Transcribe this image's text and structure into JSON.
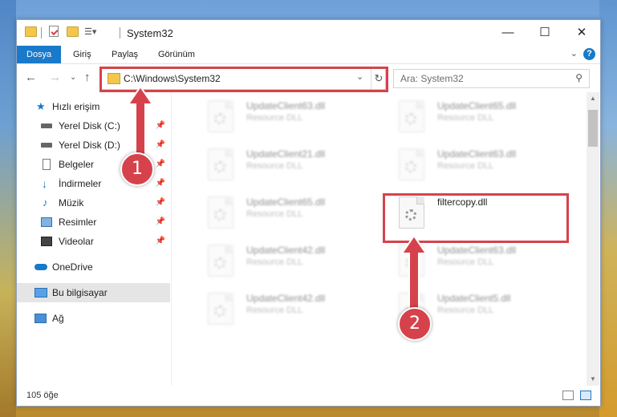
{
  "window": {
    "title": "System32",
    "controls": {
      "minimize": "—",
      "maximize": "☐",
      "close": "✕"
    }
  },
  "ribbon": {
    "tabs": [
      {
        "label": "Dosya",
        "active": true
      },
      {
        "label": "Giriş"
      },
      {
        "label": "Paylaş"
      },
      {
        "label": "Görünüm"
      }
    ],
    "help": "?"
  },
  "navigation": {
    "address": "C:\\Windows\\System32",
    "search_placeholder": "Ara: System32"
  },
  "sidebar": {
    "quick_access": "Hızlı erişim",
    "items": [
      {
        "label": "Yerel Disk (C:)",
        "icon": "drive-icon",
        "pinned": true
      },
      {
        "label": "Yerel Disk (D:)",
        "icon": "drive-icon",
        "pinned": true
      },
      {
        "label": "Belgeler",
        "icon": "documents-icon",
        "pinned": true
      },
      {
        "label": "İndirmeler",
        "icon": "downloads-icon",
        "pinned": true
      },
      {
        "label": "Müzik",
        "icon": "music-icon",
        "pinned": true
      },
      {
        "label": "Resimler",
        "icon": "pictures-icon",
        "pinned": true
      },
      {
        "label": "Videolar",
        "icon": "videos-icon",
        "pinned": true
      }
    ],
    "onedrive": "OneDrive",
    "this_pc": "Bu bilgisayar",
    "network": "Ağ"
  },
  "files": [
    {
      "name": "UpdateClient63.dll",
      "type": "Resource DLL"
    },
    {
      "name": "UpdateClient65.dll",
      "type": "Resource DLL"
    },
    {
      "name": "UpdateClient21.dll",
      "type": "Resource DLL"
    },
    {
      "name": "UpdateClient63.dll",
      "type": "Resource DLL"
    },
    {
      "name": "UpdateClient65.dll",
      "type": "Resource DLL"
    },
    {
      "name": "filtercopy.dll",
      "type": ""
    },
    {
      "name": "UpdateClient42.dll",
      "type": "Resource DLL"
    },
    {
      "name": "UpdateClient63.dll",
      "type": "Resource DLL"
    },
    {
      "name": "UpdateClient42.dll",
      "type": "Resource DLL"
    },
    {
      "name": "UpdateClient5.dll",
      "type": "Resource DLL"
    }
  ],
  "status": {
    "item_count": "105 öğe"
  },
  "callouts": {
    "step1": "1",
    "step2": "2"
  },
  "colors": {
    "accent": "#1979ca",
    "highlight": "#d6424b"
  }
}
